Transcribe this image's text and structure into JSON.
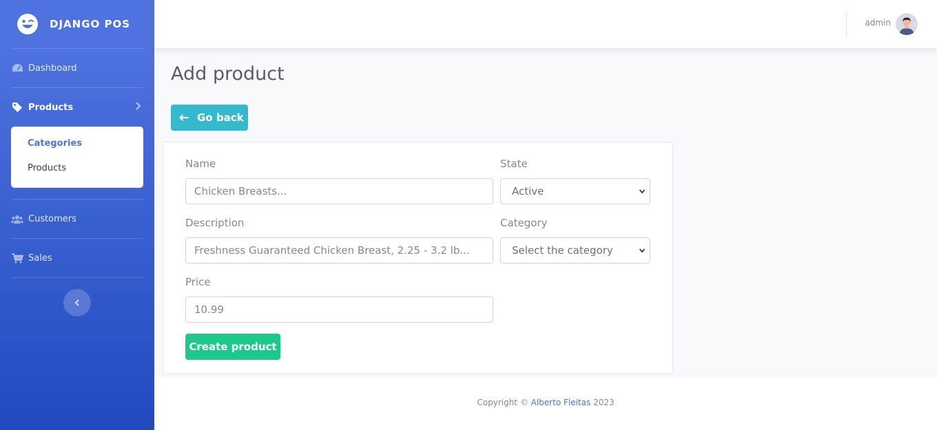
{
  "brand": {
    "name": "DJANGO POS",
    "icon": "laugh-wink-icon"
  },
  "sidebar": {
    "items": [
      {
        "label": "Dashboard",
        "icon": "tachometer-icon"
      },
      {
        "label": "Products",
        "icon": "tag-icon",
        "active": true
      },
      {
        "label": "Customers",
        "icon": "users-icon"
      },
      {
        "label": "Sales",
        "icon": "cart-icon"
      }
    ],
    "submenu": [
      {
        "label": "Categories",
        "active": true
      },
      {
        "label": "Products"
      }
    ]
  },
  "topbar": {
    "user_name": "admin"
  },
  "page": {
    "title": "Add product",
    "back_label": "Go back"
  },
  "form": {
    "name_label": "Name",
    "name_value": "Chicken Breasts...",
    "state_label": "State",
    "state_value": "Active",
    "description_label": "Description",
    "description_value": "Freshness Guaranteed Chicken Breast, 2.25 - 3.2 lb...",
    "category_label": "Category",
    "category_value": "Select the category",
    "price_label": "Price",
    "price_value": "10.99",
    "submit_label": "Create product"
  },
  "footer": {
    "prefix": "Copyright © ",
    "author": "Alberto Fleitas",
    "year": " 2023"
  },
  "colors": {
    "primary": "#4e73df",
    "info": "#36b9cc",
    "success": "#1cc88a"
  }
}
